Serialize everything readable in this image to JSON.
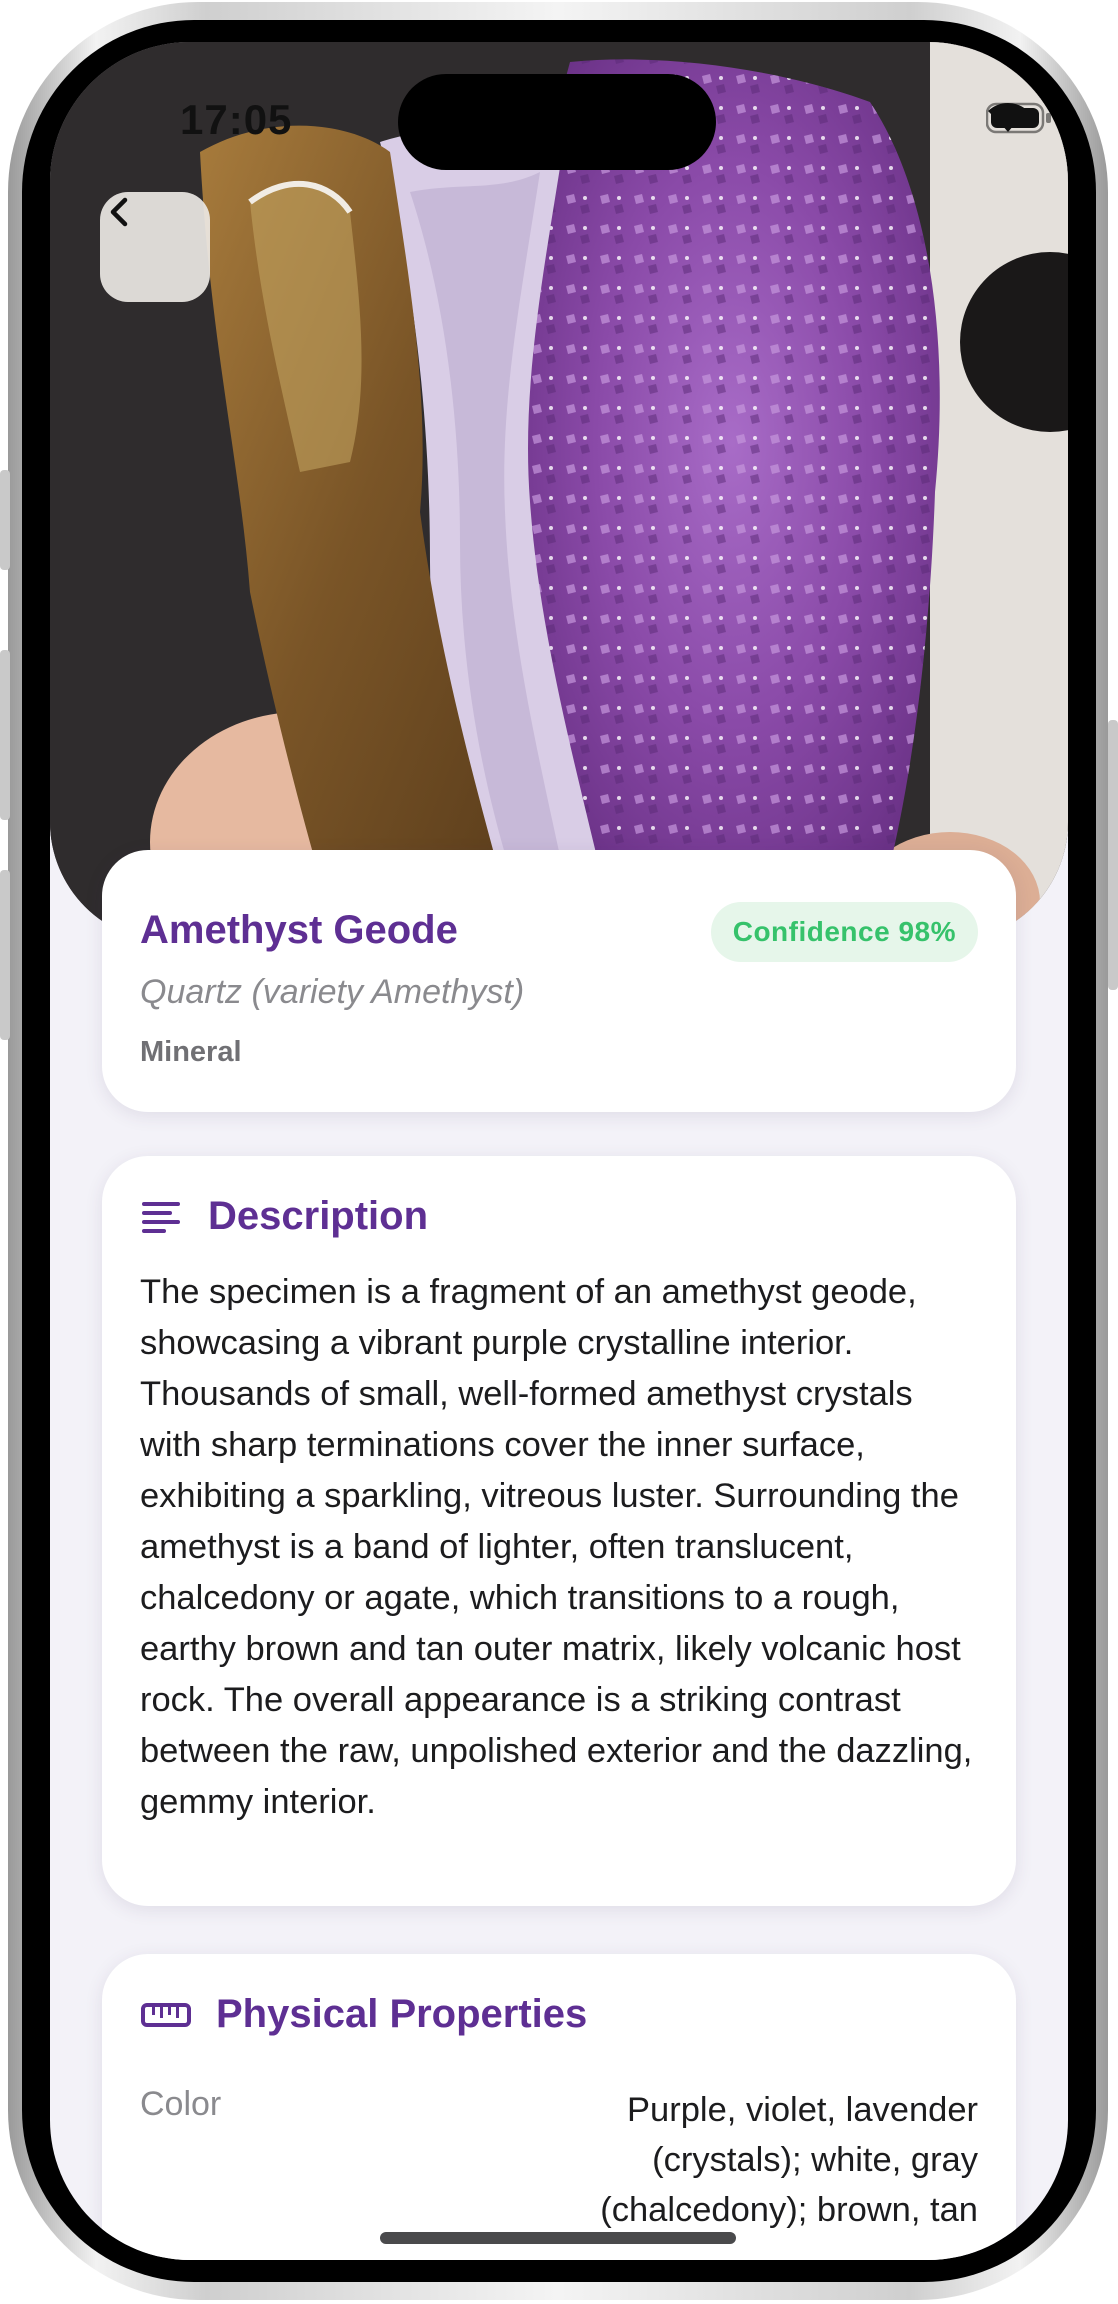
{
  "status_bar": {
    "time": "17:05"
  },
  "identification": {
    "name": "Amethyst Geode",
    "scientific_name": "Quartz (variety Amethyst)",
    "category": "Mineral",
    "confidence_label": "Confidence 98%",
    "confidence": 0.98
  },
  "description": {
    "title": "Description",
    "text": "The specimen is a fragment of an amethyst geode, showcasing a vibrant purple crystalline interior. Thousands of small, well-formed amethyst crystals with sharp terminations cover the inner surface, exhibiting a sparkling, vitreous luster. Surrounding the amethyst is a band of lighter, often translucent, chalcedony or agate, which transitions to a rough, earthy brown and tan outer matrix, likely volcanic host rock. The overall appearance is a striking contrast between the raw, unpolished exterior and the dazzling, gemmy interior."
  },
  "physical_properties": {
    "title": "Physical Properties",
    "rows": [
      {
        "label": "Color",
        "value": "Purple, violet, lavender (crystals); white, gray (chalcedony); brown, tan"
      }
    ]
  },
  "colors": {
    "accent": "#5e2f93",
    "confidence_text": "#36c26b",
    "confidence_bg": "#e6f6ea",
    "background": "#f3f2f8"
  },
  "icons": {
    "back": "chevron-left-icon",
    "description": "text-lines-icon",
    "properties": "ruler-icon"
  }
}
